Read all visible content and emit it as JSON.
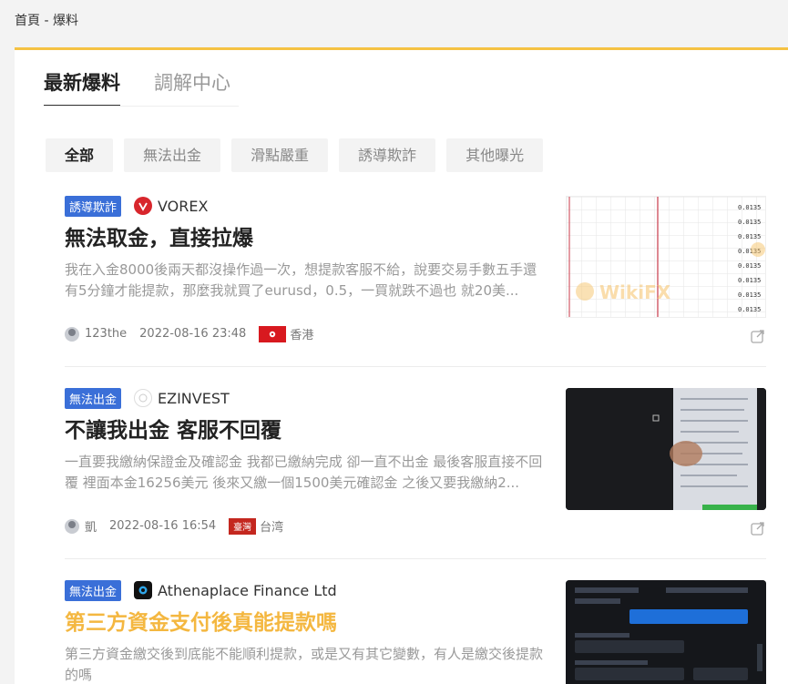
{
  "breadcrumb": "首頁 - 爆料",
  "tabs": [
    {
      "label": "最新爆料",
      "active": true
    },
    {
      "label": "調解中心",
      "active": false
    }
  ],
  "filters": [
    {
      "label": "全部",
      "active": true
    },
    {
      "label": "無法出金",
      "active": false
    },
    {
      "label": "滑點嚴重",
      "active": false
    },
    {
      "label": "誘導欺詐",
      "active": false
    },
    {
      "label": "其他曝光",
      "active": false
    }
  ],
  "posts": [
    {
      "tag": "誘導欺詐",
      "broker": "VOREX",
      "title": "無法取金，直接拉爆",
      "desc": "我在入金8000後兩天都沒操作過一次，想提款客服不給，說要交易手數五手還有5分鐘才能提款，那麼我就買了eurusd，0.5，一買就跌不過也 就20美...",
      "user": "123the",
      "time": "2022-08-16 23:48",
      "region": "香港",
      "thumb_watermark": "WikiFX"
    },
    {
      "tag": "無法出金",
      "broker": "EZINVEST",
      "title": "不讓我出金 客服不回覆",
      "desc": "一直要我繳納保證金及確認金 我都已繳納完成 卻一直不出金 最後客服直接不回覆 裡面本金16256美元 後來又繳一個1500美元確認金 之後又要我繳納2...",
      "user": "凱",
      "time": "2022-08-16 16:54",
      "region": "台湾",
      "region_badge": "臺灣"
    },
    {
      "tag": "無法出金",
      "broker": "Athenaplace Finance Ltd",
      "title": "第三方資金支付後真能提款嗎",
      "desc": "第三方資金繳交後到底能不能順利提款，或是又有其它變數，有人是繳交後提款的嗎"
    }
  ],
  "colors": {
    "accent": "#f5c243",
    "tag": "#3a6fd8",
    "highlight_title": "#f4b740"
  }
}
